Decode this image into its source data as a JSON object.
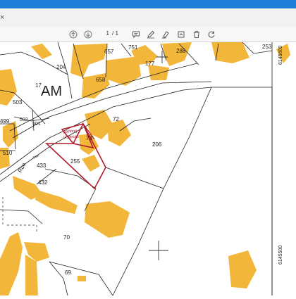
{
  "toolbar": {
    "page_current": "1",
    "page_total": "/ 1",
    "icons": [
      "arrow-up-icon",
      "arrow-down-icon",
      "comment-icon",
      "draw-icon",
      "highlight-icon",
      "fill-sign-icon",
      "trash-icon",
      "rotate-icon"
    ]
  },
  "map": {
    "section_label": "AM",
    "street_label": "Rue",
    "annotation_line1": "parking",
    "annotation_line2": "visiteurs",
    "coordinate_right_top": "6145600",
    "coordinate_right_bottom": "6145500",
    "parcels": [
      "657",
      "751",
      "288",
      "253",
      "204",
      "177",
      "658",
      "17",
      "503",
      "502",
      "501",
      "499",
      "510",
      "72",
      "73",
      "206",
      "433",
      "255",
      "432",
      "70",
      "69",
      "Pas"
    ],
    "highlight_color": "#b01c2c",
    "building_color": "#f2b63a"
  }
}
